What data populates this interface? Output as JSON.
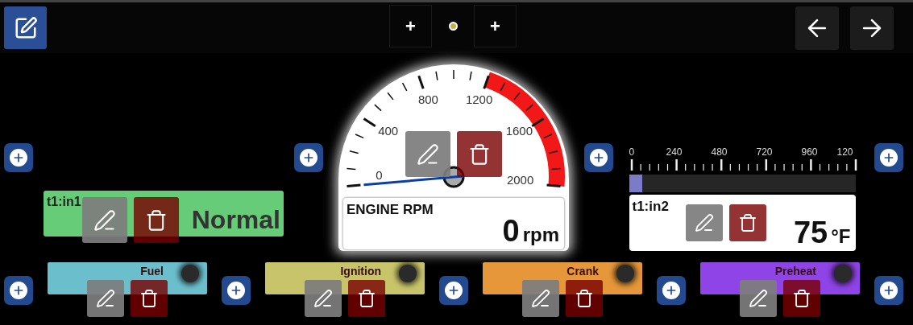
{
  "toolbar": {
    "edit_selected": true,
    "add_left": "+",
    "add_right": "+",
    "pages": [
      {
        "selected": true
      }
    ]
  },
  "row_top": [
    {
      "kind": "text",
      "title": "t1:in1",
      "value": "Normal",
      "color": "#66cc77"
    },
    {
      "kind": "dial",
      "title": "ENGINE RPM",
      "value": "0",
      "unit": "rpm",
      "at_rest": true,
      "ticks": [
        "0",
        "400",
        "800",
        "1200",
        "1600",
        "2000"
      ]
    },
    {
      "kind": "bar",
      "title": "t1:in2",
      "value": "75",
      "unit": "°F",
      "level": 0.06,
      "ticks": [
        "0",
        "240",
        "480",
        "720",
        "960",
        "120"
      ]
    }
  ],
  "row_bottom": [
    {
      "label": "Fuel",
      "color": "#6bbfcc",
      "on": false
    },
    {
      "label": "Ignition",
      "color": "#c8c46a",
      "on": false
    },
    {
      "label": "Crank",
      "color": "#e5973a",
      "on": false
    },
    {
      "label": "Preheat",
      "color": "#8e44e6",
      "on": false
    }
  ]
}
